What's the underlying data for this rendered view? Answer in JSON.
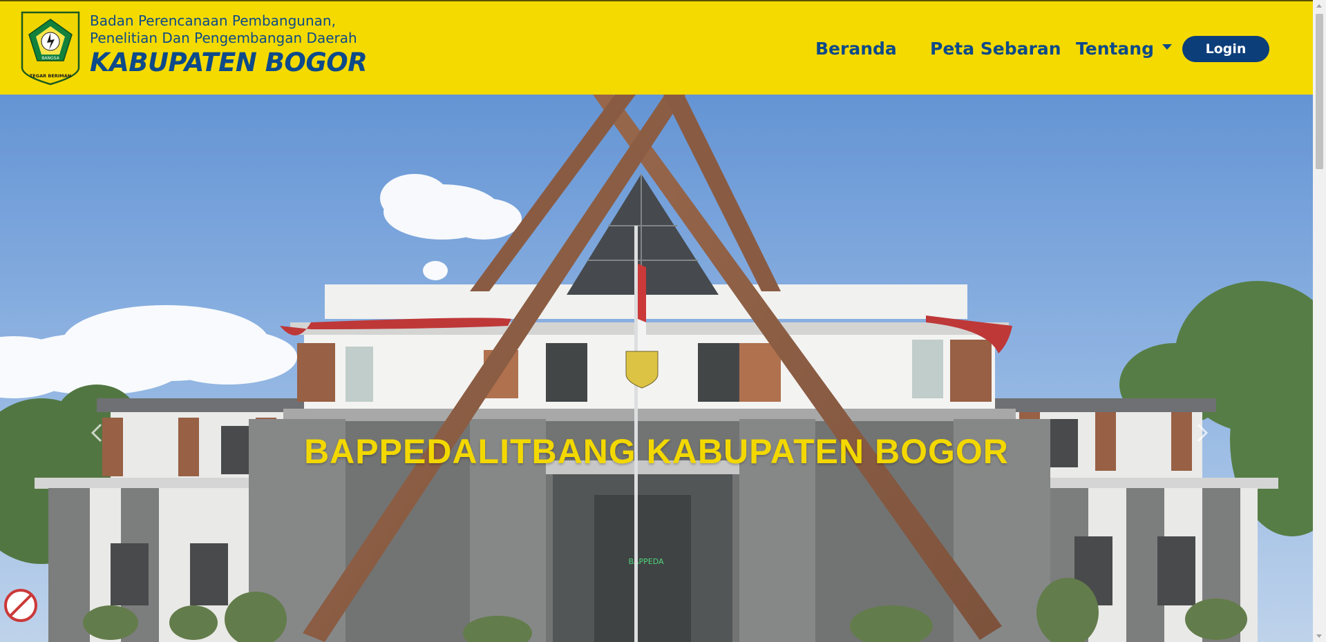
{
  "header": {
    "brand_line1": "Badan Perencanaan Pembangunan,",
    "brand_line2": "Penelitian Dan Pengembangan Daerah",
    "brand_line3": "KABUPATEN BOGOR",
    "logo_text_top": "BANGSA",
    "logo_text_bottom": "TEGAR BERIMAN",
    "colors": {
      "background": "#f5da00",
      "text": "#0d4a8a",
      "button": "#0c3e7a"
    }
  },
  "nav": {
    "home": "Beranda",
    "map": "Peta Sebaran",
    "about": "Tentang",
    "login": "Login"
  },
  "hero": {
    "caption": "BAPPEDALITBANG KABUPATEN BOGOR",
    "building_sign": "BAPPEDA",
    "caption_color": "#f3d800",
    "prev_icon": "chevron-left-icon",
    "next_icon": "chevron-right-icon"
  }
}
